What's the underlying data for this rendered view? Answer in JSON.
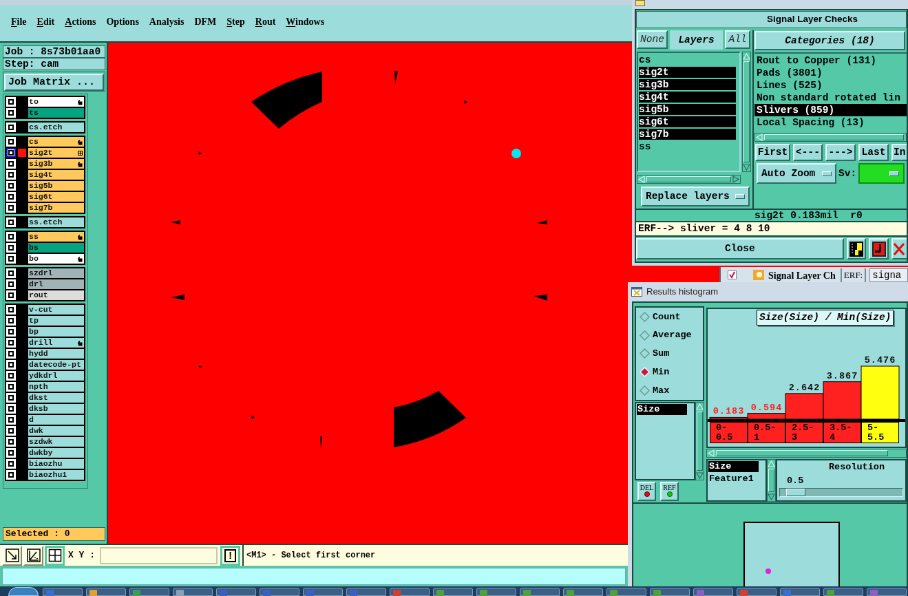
{
  "menu_bar": {
    "items": [
      {
        "label": "File",
        "mnemonic": true
      },
      {
        "label": "Edit",
        "mnemonic": true
      },
      {
        "label": "Actions",
        "mnemonic": true
      },
      {
        "label": "Options",
        "mnemonic": false
      },
      {
        "label": "Analysis",
        "mnemonic": false
      },
      {
        "label": "DFM",
        "mnemonic": false
      },
      {
        "label": "Step",
        "mnemonic": true
      },
      {
        "label": "Rout",
        "mnemonic": true
      },
      {
        "label": "Windows",
        "mnemonic": true
      }
    ]
  },
  "side_panel": {
    "job": "Job : 8s73b01aa0",
    "step": "Step: cam",
    "job_matrix_button": "Job Matrix ...",
    "layer_groups": [
      {
        "layers": [
          {
            "name": "to",
            "color": "#ffffff",
            "kind": "hand",
            "focused": false,
            "displayed": false
          },
          {
            "name": "ts",
            "color": "#05a37f",
            "kind": "plain",
            "focused": false,
            "displayed": false
          }
        ]
      },
      {
        "layers": [
          {
            "name": "cs.etch",
            "color": "#9cdcda",
            "kind": "plain",
            "focused": false,
            "displayed": false
          }
        ]
      },
      {
        "layers": [
          {
            "name": "cs",
            "color": "#ffc95c",
            "kind": "hand",
            "focused": false,
            "displayed": false
          },
          {
            "name": "sig2t",
            "color": "#ffc95c",
            "kind": "grid",
            "focused": true,
            "displayed": true
          },
          {
            "name": "sig3b",
            "color": "#ffc95c",
            "kind": "hand",
            "focused": false,
            "displayed": false
          },
          {
            "name": "sig4t",
            "color": "#ffc95c",
            "kind": "plain",
            "focused": false,
            "displayed": false
          },
          {
            "name": "sig5b",
            "color": "#ffc95c",
            "kind": "plain",
            "focused": false,
            "displayed": false
          },
          {
            "name": "sig6t",
            "color": "#ffc95c",
            "kind": "plain",
            "focused": false,
            "displayed": false
          },
          {
            "name": "sig7b",
            "color": "#ffc95c",
            "kind": "plain",
            "focused": false,
            "displayed": false
          }
        ]
      },
      {
        "layers": [
          {
            "name": "ss.etch",
            "color": "#9cdcda",
            "kind": "plain",
            "focused": false,
            "displayed": false
          }
        ]
      },
      {
        "layers": [
          {
            "name": "ss",
            "color": "#ffc95c",
            "kind": "hand",
            "focused": false,
            "displayed": false
          },
          {
            "name": "bs",
            "color": "#05a37f",
            "kind": "plain",
            "focused": false,
            "displayed": false
          },
          {
            "name": "bo",
            "color": "#ffffff",
            "kind": "hand",
            "focused": false,
            "displayed": false
          }
        ]
      },
      {
        "layers": [
          {
            "name": "szdrl",
            "color": "#a0b3b6",
            "kind": "plain",
            "focused": false,
            "displayed": false
          },
          {
            "name": "drl",
            "color": "#a0b3b6",
            "kind": "plain",
            "focused": false,
            "displayed": false
          },
          {
            "name": "rout",
            "color": "#dcdcdc",
            "kind": "plain",
            "focused": false,
            "displayed": false
          }
        ]
      },
      {
        "layers": [
          {
            "name": "v-cut",
            "color": "#9cdcda",
            "kind": "plain",
            "focused": false,
            "displayed": false
          },
          {
            "name": "tp",
            "color": "#9cdcda",
            "kind": "plain",
            "focused": false,
            "displayed": false
          },
          {
            "name": "bp",
            "color": "#9cdcda",
            "kind": "plain",
            "focused": false,
            "displayed": false
          },
          {
            "name": "drill",
            "color": "#9cdcda",
            "kind": "hand",
            "focused": false,
            "displayed": false
          },
          {
            "name": "hydd",
            "color": "#9cdcda",
            "kind": "plain",
            "focused": false,
            "displayed": false
          },
          {
            "name": "datecode-pt",
            "color": "#9cdcda",
            "kind": "plain",
            "focused": false,
            "displayed": false
          },
          {
            "name": "ydkdrl",
            "color": "#9cdcda",
            "kind": "plain",
            "focused": false,
            "displayed": false
          },
          {
            "name": "npth",
            "color": "#9cdcda",
            "kind": "plain",
            "focused": false,
            "displayed": false
          },
          {
            "name": "dkst",
            "color": "#9cdcda",
            "kind": "plain",
            "focused": false,
            "displayed": false
          },
          {
            "name": "dksb",
            "color": "#9cdcda",
            "kind": "plain",
            "focused": false,
            "displayed": false
          },
          {
            "name": "d",
            "color": "#9cdcda",
            "kind": "plain",
            "focused": false,
            "displayed": false
          },
          {
            "name": "dwk",
            "color": "#9cdcda",
            "kind": "plain",
            "focused": false,
            "displayed": false
          },
          {
            "name": "szdwk",
            "color": "#9cdcda",
            "kind": "plain",
            "focused": false,
            "displayed": false
          },
          {
            "name": "dwkby",
            "color": "#9cdcda",
            "kind": "plain",
            "focused": false,
            "displayed": false
          },
          {
            "name": "biaozhu",
            "color": "#9cdcda",
            "kind": "plain",
            "focused": false,
            "displayed": false
          },
          {
            "name": "biaozhu1",
            "color": "#9cdcda",
            "kind": "plain",
            "focused": false,
            "displayed": false
          }
        ]
      }
    ],
    "selected_count": "Selected : 0"
  },
  "tool_bar": {
    "tools": [
      {
        "kind": "arrow",
        "selected": false
      },
      {
        "kind": "angle",
        "selected": false
      },
      {
        "kind": "grid",
        "selected": true
      }
    ],
    "xy_label": "X Y :",
    "alert_button": "!",
    "prompt": "<M1> - Select first corner"
  },
  "results_viewer": {
    "title": "Signal Layer Checks",
    "none_button": "None",
    "layers_label": "Layers",
    "all_button": "All",
    "layers": [
      {
        "name": "cs",
        "selected": false
      },
      {
        "name": "sig2t",
        "selected": true
      },
      {
        "name": "sig3b",
        "selected": true
      },
      {
        "name": "sig4t",
        "selected": true
      },
      {
        "name": "sig5b",
        "selected": true
      },
      {
        "name": "sig6t",
        "selected": true
      },
      {
        "name": "sig7b",
        "selected": true
      },
      {
        "name": "ss",
        "selected": false
      }
    ],
    "layer_mode": "Replace layers",
    "categories_button": "Categories (18)",
    "categories": [
      {
        "label": "Rout to Copper (131)",
        "selected": false
      },
      {
        "label": "Pads (3801)",
        "selected": false
      },
      {
        "label": "Lines (525)",
        "selected": false
      },
      {
        "label": "Non standard rotated lin",
        "selected": false
      },
      {
        "label": "Slivers (859)",
        "selected": true
      },
      {
        "label": "Local Spacing (13)",
        "selected": false
      }
    ],
    "nav_buttons": [
      "First",
      "<---",
      "--->",
      "Last",
      "In"
    ],
    "zoom_mode": "Auto Zoom",
    "sv_label": "Sv:",
    "feature_info": "sig2t 0.183mil  r0",
    "erf_message": "ERF--> sliver = 4 8 10",
    "close_button": "Close"
  },
  "background_window": {
    "title": "Signal Layer Ch",
    "erf_label": "ERF:",
    "field_value": "signa"
  },
  "results_histogram": {
    "title": "Results histogram",
    "functions": [
      {
        "label": "Count",
        "selected": false
      },
      {
        "label": "Average",
        "selected": false
      },
      {
        "label": "Sum",
        "selected": false
      },
      {
        "label": "Min",
        "selected": true
      },
      {
        "label": "Max",
        "selected": false
      }
    ],
    "fields": [
      {
        "label": "Size",
        "selected": true
      }
    ],
    "del_button": "DEL",
    "ref_button": "REF",
    "chart_data": {
      "type": "bar",
      "title": "Size(Size) / Min(Size)",
      "categories": [
        "0-0.5",
        "0.5-1",
        "2.5-3",
        "3.5-4",
        "5-5.5"
      ],
      "series": [
        {
          "color": "#ff2020",
          "values": [
            0.183,
            0.594,
            2.642,
            3.867,
            null
          ]
        },
        {
          "color": "#ffff10",
          "values": [
            null,
            null,
            null,
            null,
            5.476
          ]
        }
      ],
      "stacked": true,
      "data_labels": true
    },
    "x_fields": [
      {
        "label": "Size",
        "selected": true
      },
      {
        "label": "Feature1",
        "selected": false
      }
    ],
    "resolution": {
      "label": "Resolution",
      "value": "0.5",
      "level": 0.06
    }
  }
}
